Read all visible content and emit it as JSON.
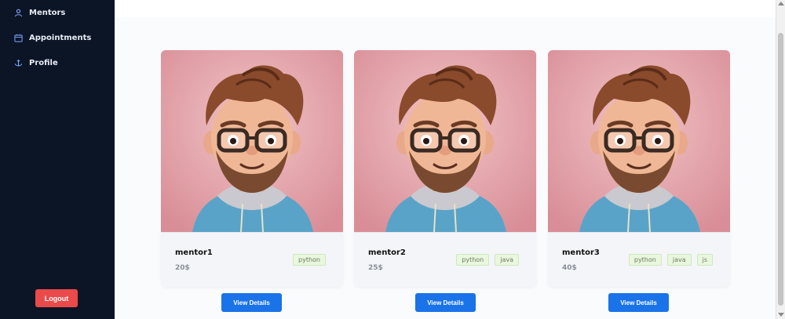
{
  "sidebar": {
    "items": [
      {
        "label": "Mentors",
        "icon": "user-icon"
      },
      {
        "label": "Appointments",
        "icon": "calendar-icon"
      },
      {
        "label": "Profile",
        "icon": "anchor-icon"
      }
    ],
    "logout_label": "Logout"
  },
  "mentors": [
    {
      "name": "mentor1",
      "price": "20$",
      "tags": [
        "python"
      ],
      "button_label": "View Details"
    },
    {
      "name": "mentor2",
      "price": "25$",
      "tags": [
        "python",
        "java"
      ],
      "button_label": "View Details"
    },
    {
      "name": "mentor3",
      "price": "40$",
      "tags": [
        "python",
        "java",
        "js"
      ],
      "button_label": "View Details"
    }
  ],
  "colors": {
    "sidebar_bg": "#0b1526",
    "logout": "#ea4a4a",
    "primary_button": "#1a73e8",
    "tag_bg": "#eaf7df",
    "avatar_bg": "#e6a7ae"
  }
}
